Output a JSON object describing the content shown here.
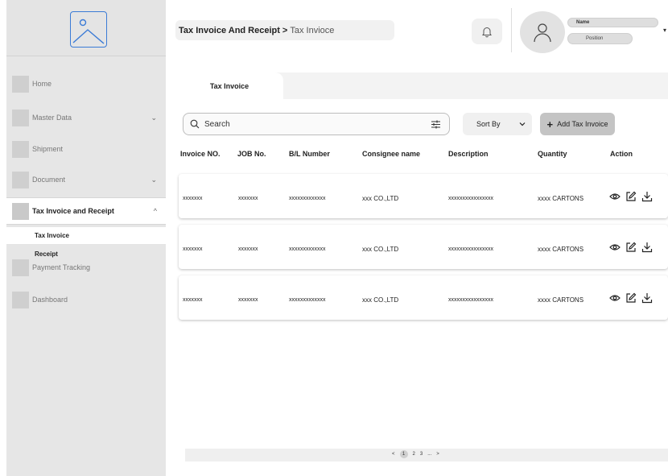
{
  "sidebar": {
    "logo_icon": "image-placeholder-icon",
    "items": [
      {
        "label": "Home"
      },
      {
        "label": "Master Data",
        "chevron": "⌄"
      },
      {
        "label": "Shipment"
      },
      {
        "label": "Document",
        "chevron": "⌄"
      },
      {
        "label": "Tax Invoice and Receipt",
        "chevron": "^"
      },
      {
        "label": "Payment Tracking"
      },
      {
        "label": "Dashboard"
      }
    ],
    "sub_items": [
      {
        "label": "Tax Invoice"
      },
      {
        "label": "Receipt"
      }
    ]
  },
  "header": {
    "breadcrumb": {
      "parent": "Tax Invoice And Receipt",
      "separator": ">",
      "current": "Tax Invioce"
    },
    "profile": {
      "name": "Name",
      "position": "Position",
      "caret": "▾"
    }
  },
  "main": {
    "tab": {
      "label": "Tax Invoice"
    },
    "search": {
      "placeholder": "Search"
    },
    "sort": {
      "label": "Sort By"
    },
    "add_button": {
      "icon": "+",
      "label": "Add Tax Invoice"
    },
    "table": {
      "columns": [
        "Invoice NO.",
        "JOB No.",
        "B/L Number",
        "Consignee name",
        "Description",
        "Quantity",
        "Action"
      ],
      "rows": [
        [
          "xxxxxxx",
          "xxxxxxx",
          "xxxxxxxxxxxxx",
          "xxx CO.,LTD",
          "xxxxxxxxxxxxxxxx",
          "xxxx CARTONS"
        ],
        [
          "xxxxxxx",
          "xxxxxxx",
          "xxxxxxxxxxxxx",
          "xxx CO.,LTD",
          "xxxxxxxxxxxxxxxx",
          "xxxx CARTONS"
        ],
        [
          "xxxxxxx",
          "xxxxxxx",
          "xxxxxxxxxxxxx",
          "xxx CO.,LTD",
          "xxxxxxxxxxxxxxxx",
          "xxxx CARTONS"
        ]
      ]
    },
    "pagination": {
      "prev": "<",
      "pages": [
        "1",
        "2",
        "3"
      ],
      "ellipsis": "...",
      "next": ">"
    }
  },
  "colors": {
    "accent_logo": "#3b7bd6",
    "sidebar_bg": "#e6e6e6",
    "button_gray": "#c4c4c4"
  }
}
